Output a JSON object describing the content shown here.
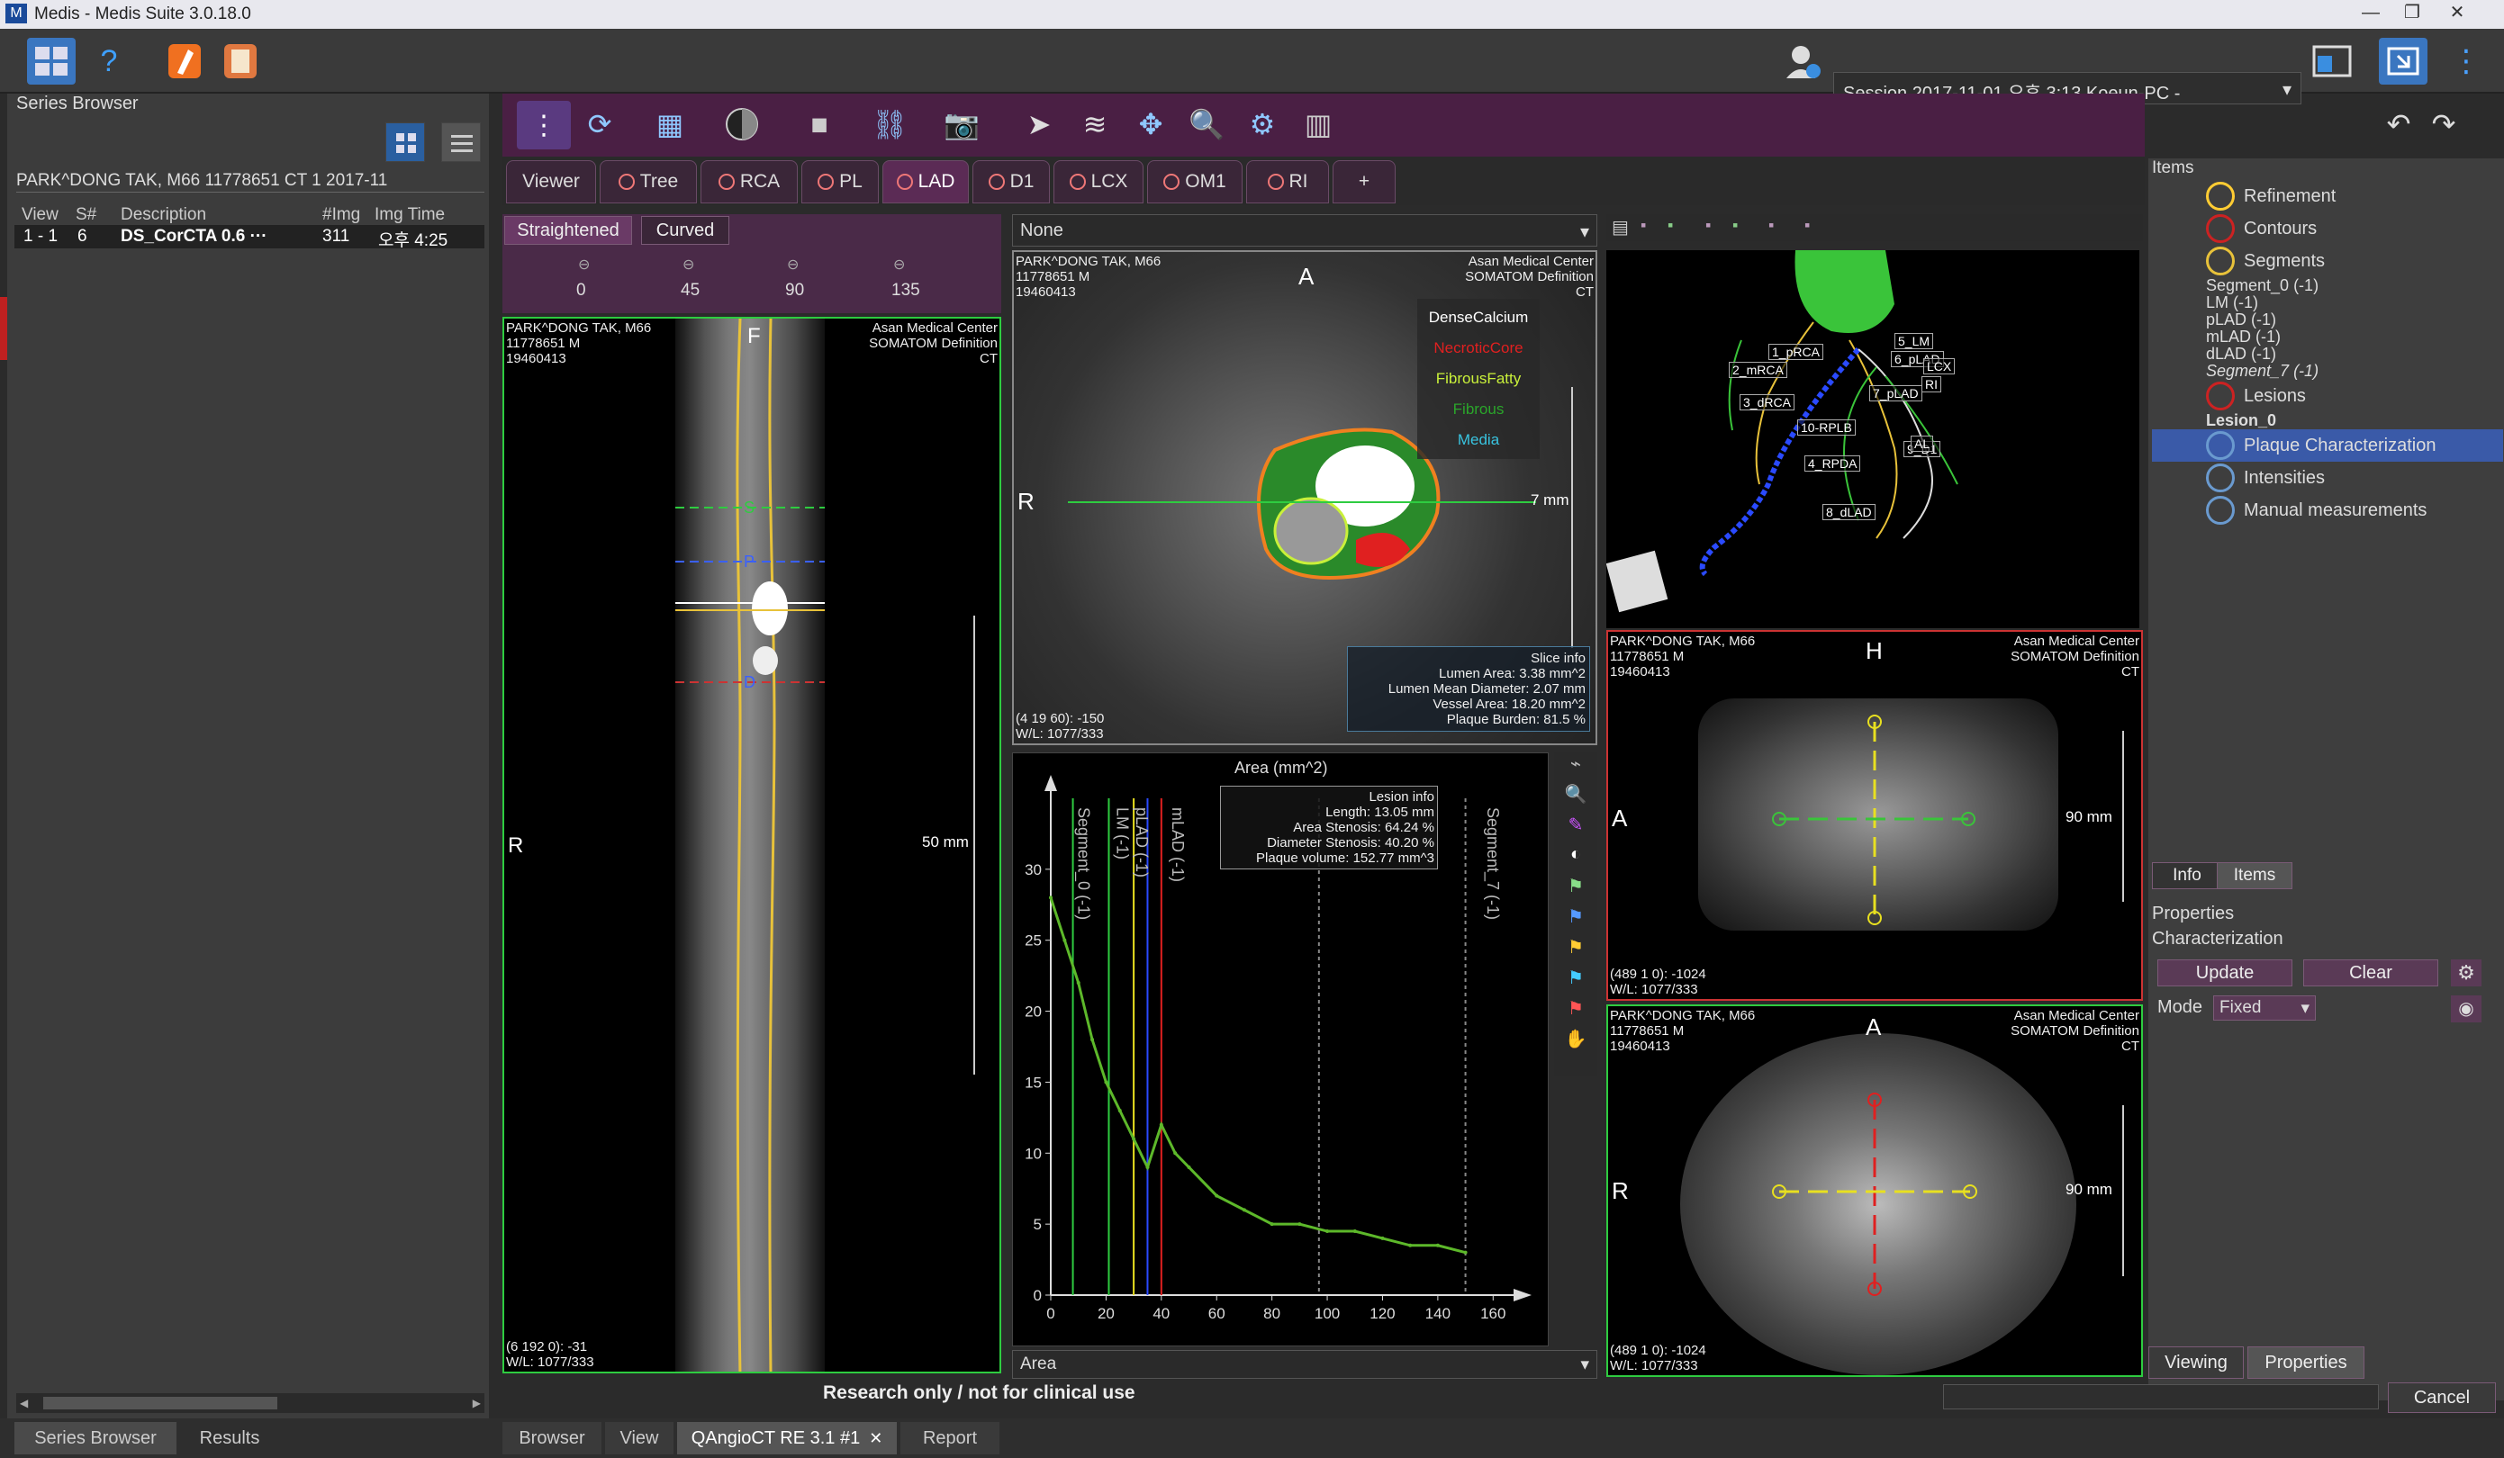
{
  "window": {
    "title": "Medis - Medis Suite 3.0.18.0",
    "app_icon_letter": "M",
    "minimize": "—",
    "restore": "❐",
    "close": "✕"
  },
  "toolbar": {
    "session": "Session 2017-11-01 오후 3:13 Koeun-PC -",
    "more": "⋮"
  },
  "series_browser": {
    "title": "Series Browser",
    "patient_header": "PARK^DONG TAK, M66 11778651 CT 1 2017-11",
    "columns": [
      "View",
      "S#",
      "Description",
      "#Img",
      "Img Time"
    ],
    "rows": [
      {
        "view": "1 - 1",
        "s": "6",
        "desc": "DS_CorCTA  0.6  ···",
        "img": "311",
        "time": "오후 4:25"
      }
    ]
  },
  "tabs": [
    {
      "label": "Viewer",
      "dot": false
    },
    {
      "label": "Tree",
      "dot": true
    },
    {
      "label": "RCA",
      "dot": true
    },
    {
      "label": "PL",
      "dot": true
    },
    {
      "label": "LAD",
      "dot": true,
      "active": true
    },
    {
      "label": "D1",
      "dot": true
    },
    {
      "label": "LCX",
      "dot": true
    },
    {
      "label": "OM1",
      "dot": true
    },
    {
      "label": "RI",
      "dot": true
    },
    {
      "label": "+",
      "dot": false
    }
  ],
  "straight_view": {
    "tab_straightened": "Straightened",
    "tab_curved": "Curved",
    "angles": [
      "0",
      "45",
      "90",
      "135"
    ],
    "patient_info": "PARK^DONG TAK, M66\n11778651 M\n19460413",
    "hospital": "Asan Medical Center\nSOMATOM Definition\nCT",
    "label_top": "F",
    "label_left": "R",
    "labels_s": "S",
    "labels_p": "P",
    "labels_d": "D",
    "scale": "50 mm",
    "coords": "(6 192 0): -31\nW/L: 1077/333"
  },
  "cross_section": {
    "dropdown": "None",
    "orient_top": "A",
    "orient_left": "R",
    "patient_info": "PARK^DONG TAK, M66\n11778651 M\n19460413",
    "hospital": "Asan Medical Center\nSOMATOM Definition\nCT",
    "legend": [
      {
        "name": "DenseCalcium",
        "color": "#ffffff"
      },
      {
        "name": "NecroticCore",
        "color": "#e02020"
      },
      {
        "name": "FibrousFatty",
        "color": "#c9f03a"
      },
      {
        "name": "Fibrous",
        "color": "#2aa52a"
      },
      {
        "name": "Media",
        "color": "#39c4e0"
      }
    ],
    "scale": "7 mm",
    "slice_info_title": "Slice info",
    "slice_info": [
      "Lumen Area: 3.38 mm^2",
      "Lumen Mean Diameter: 2.07 mm",
      "Vessel Area: 18.20 mm^2",
      "Plaque Burden: 81.5 %"
    ],
    "coords": "(4 19 60): -150\nW/L: 1077/333"
  },
  "graph": {
    "title": "Area (mm^2)",
    "lesion_info_title": "Lesion info",
    "lesion_info": [
      "Length: 13.05 mm",
      "Area Stenosis: 64.24 %",
      "Diameter Stenosis: 40.20 %",
      "Plaque volume: 152.77 mm^3"
    ],
    "vlabels": [
      "Segment_0 (-1)",
      "LM (-1)",
      "pLAD (-1)",
      "mLAD (-1)",
      "Segment_7 (-1)"
    ],
    "dropdown": "Area"
  },
  "chart_data": {
    "type": "line",
    "title": "Area (mm^2)",
    "xlabel": "",
    "ylabel": "",
    "xlim": [
      0,
      160
    ],
    "ylim": [
      0,
      35
    ],
    "xticks": [
      0,
      20,
      40,
      60,
      80,
      100,
      120,
      140,
      160
    ],
    "yticks": [
      0,
      5,
      10,
      15,
      20,
      25,
      30
    ],
    "series": [
      {
        "name": "",
        "color": "#5db82a",
        "x": [
          0,
          5,
          10,
          15,
          20,
          25,
          30,
          35,
          40,
          45,
          50,
          60,
          70,
          80,
          90,
          100,
          110,
          120,
          130,
          140,
          150
        ],
        "y": [
          28,
          25,
          22,
          18,
          15,
          13,
          11,
          9,
          12,
          10,
          9,
          7,
          6,
          5,
          5,
          4.5,
          4.5,
          4,
          3.5,
          3.5,
          3
        ]
      }
    ]
  },
  "tree_view": {
    "labels": [
      "1_pRCA",
      "2_mRCA",
      "3_dRCA",
      "4_RPDA",
      "10-RPLB",
      "5_LM",
      "6_pLAD",
      "7_pLAD",
      "8_dLAD",
      "9_D1",
      "RI",
      "LCX",
      "AL"
    ]
  },
  "sagittal": {
    "orient_top": "H",
    "orient_left": "A",
    "patient_info": "PARK^DONG TAK, M66\n11778651 M\n19460413",
    "hospital": "Asan Medical Center\nSOMATOM Definition\nCT",
    "scale": "90 mm",
    "coords": "(489 1 0): -1024\nW/L: 1077/333"
  },
  "axial": {
    "orient_top": "A",
    "orient_left": "R",
    "patient_info": "PARK^DONG TAK, M66\n11778651 M\n19460413",
    "hospital": "Asan Medical Center\nSOMATOM Definition\nCT",
    "scale": "90 mm",
    "coords": "(489 1 0): -1024\nW/L: 1077/333"
  },
  "items_panel": {
    "title": "Items",
    "entries": [
      {
        "label": "Refinement",
        "indent": 1,
        "icon": "refinement"
      },
      {
        "label": "Contours",
        "indent": 1,
        "icon": "contours"
      },
      {
        "label": "Segments",
        "indent": 1,
        "icon": "segments"
      },
      {
        "label": "Segment_0 (-1)",
        "indent": 2
      },
      {
        "label": "LM (-1)",
        "indent": 2
      },
      {
        "label": "pLAD (-1)",
        "indent": 2
      },
      {
        "label": "mLAD (-1)",
        "indent": 2
      },
      {
        "label": "dLAD (-1)",
        "indent": 2
      },
      {
        "label": "Segment_7 (-1)",
        "indent": 2,
        "italic": true
      },
      {
        "label": "Lesions",
        "indent": 1,
        "icon": "lesions"
      },
      {
        "label": "Lesion_0",
        "indent": 2,
        "bold": true
      },
      {
        "label": "Plaque Characterization",
        "indent": 3,
        "selected": true
      },
      {
        "label": "Intensities",
        "indent": 3
      },
      {
        "label": "Manual measurements",
        "indent": 3
      }
    ],
    "tab_info": "Info",
    "tab_items": "Items"
  },
  "properties": {
    "title": "Properties",
    "subtitle": "Characterization",
    "update": "Update",
    "clear": "Clear",
    "mode_label": "Mode",
    "mode_value": "Fixed",
    "tab_viewing": "Viewing",
    "tab_properties": "Properties"
  },
  "footer": {
    "disclaimer": "Research only / not for clinical use",
    "cancel": "Cancel",
    "left_tabs": [
      "Series Browser",
      "Results"
    ],
    "bottom_tabs": [
      "Browser",
      "View",
      "QAngioCT RE 3.1 #1",
      "Report"
    ],
    "close_x": "✕"
  }
}
